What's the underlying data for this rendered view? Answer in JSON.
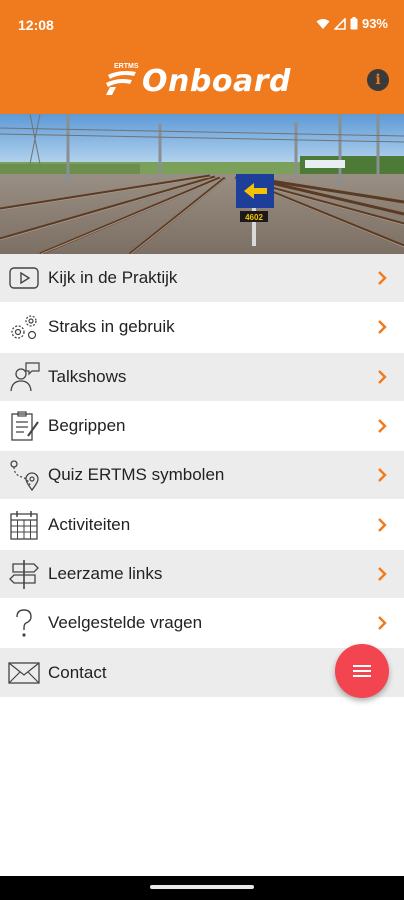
{
  "status": {
    "time": "12:08",
    "battery": "93%"
  },
  "header": {
    "brand_small": "ERTMS",
    "title": "Onboard",
    "info_symbol": "i"
  },
  "hero": {
    "sign_number": "4602"
  },
  "menu": {
    "items": [
      {
        "label": "Kijk in de Praktijk",
        "icon": "play-icon"
      },
      {
        "label": "Straks in gebruik",
        "icon": "gears-icon"
      },
      {
        "label": "Talkshows",
        "icon": "speaker-person-icon"
      },
      {
        "label": "Begrippen",
        "icon": "clipboard-icon"
      },
      {
        "label": "Quiz ERTMS symbolen",
        "icon": "route-pin-icon"
      },
      {
        "label": "Activiteiten",
        "icon": "calendar-icon"
      },
      {
        "label": "Leerzame links",
        "icon": "signpost-icon"
      },
      {
        "label": "Veelgestelde vragen",
        "icon": "question-icon"
      },
      {
        "label": "Contact",
        "icon": "envelope-icon"
      }
    ]
  },
  "colors": {
    "brand_orange": "#f07a1e",
    "fab_red": "#f2454f",
    "row_alt": "#ececec"
  }
}
